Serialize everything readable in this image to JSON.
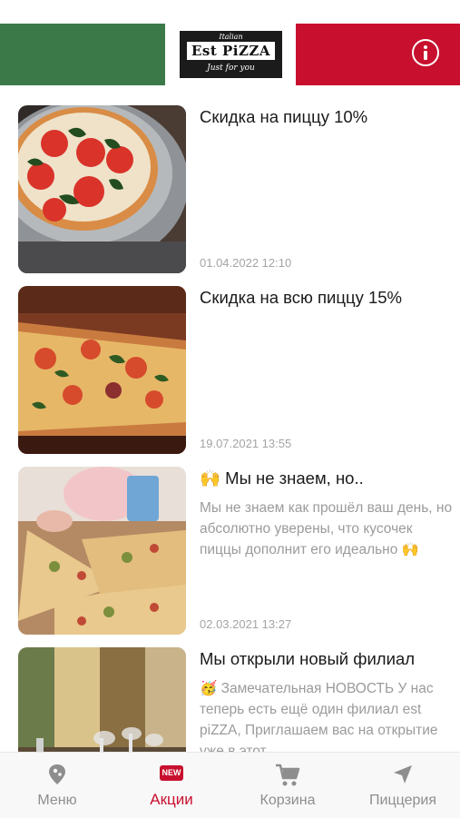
{
  "header": {
    "logo": {
      "top": "Italian",
      "name": "Est PiZZA",
      "tagline": "Just for you"
    },
    "info_icon": "info-icon"
  },
  "feed": {
    "items": [
      {
        "title": "Скидка на пиццу 10%",
        "body": "",
        "date": "01.04.2022 12:10"
      },
      {
        "title": "Скидка на всю пиццу 15%",
        "body": "",
        "date": "19.07.2021 13:55"
      },
      {
        "title": "🙌  Мы не знаем, но..",
        "body": "Мы не знаем как прошёл ваш день, но абсолютно уверены, что кусочек пиццы дополнит его идеально 🙌",
        "date": "02.03.2021 13:27"
      },
      {
        "title": "Мы открыли новый филиал",
        "body": "🥳  Замечательная НОВОСТЬ У нас  теперь есть ещё один филиал est piZZA, Приглашаем вас на открытие уже в этот",
        "date": ""
      }
    ]
  },
  "tabbar": {
    "tabs": [
      {
        "label": "Меню",
        "icon": "pin-icon",
        "active": false
      },
      {
        "label": "Акции",
        "icon": "new-badge-icon",
        "badge": "NEW",
        "active": true
      },
      {
        "label": "Корзина",
        "icon": "cart-icon",
        "active": false
      },
      {
        "label": "Пиццерия",
        "icon": "location-arrow-icon",
        "active": false
      }
    ]
  },
  "colors": {
    "green": "#3b7a48",
    "red": "#c8102e",
    "accent": "#c8102e",
    "inactive": "#8e8e8e"
  }
}
